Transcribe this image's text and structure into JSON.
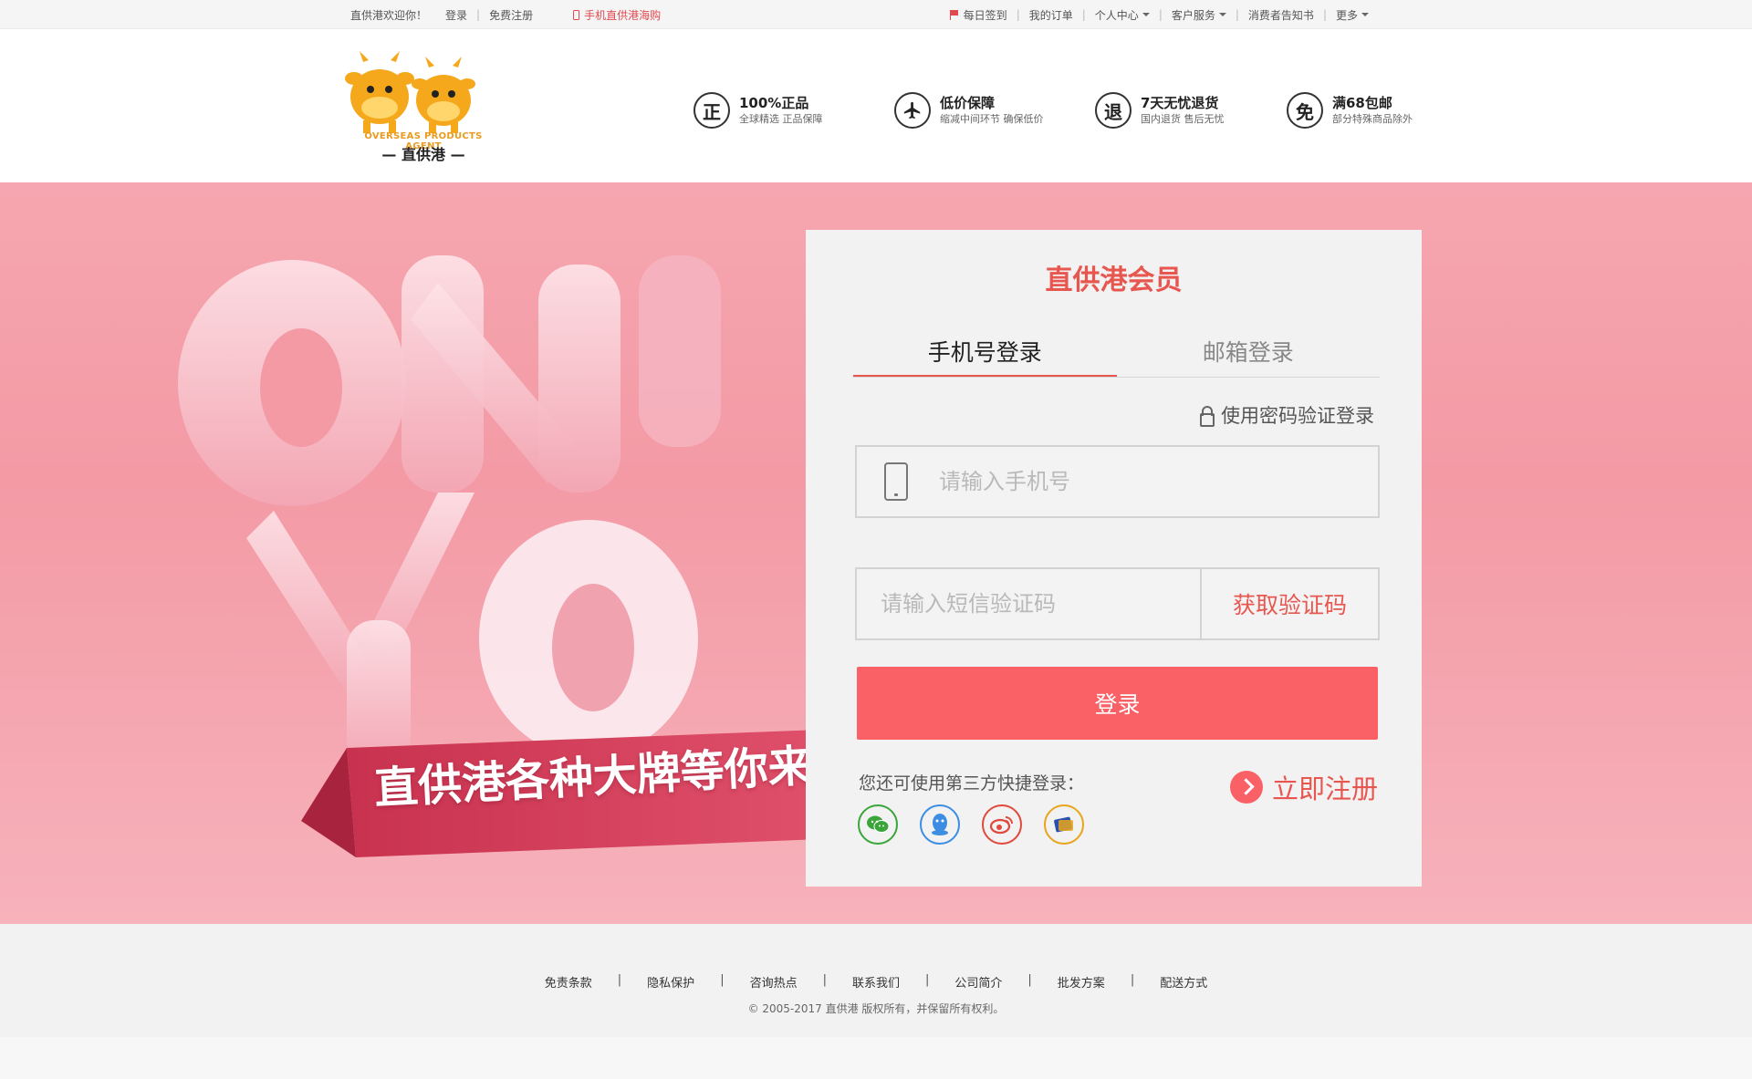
{
  "topbar": {
    "welcome": "直供港欢迎你！",
    "login": "登录",
    "register": "免费注册",
    "mobile": "手机直供港海购",
    "checkin": "每日签到",
    "orders": "我的订单",
    "personal": "个人中心",
    "service": "客户服务",
    "notice": "消费者告知书",
    "more": "更多"
  },
  "logo": {
    "sub": "OVERSEAS PRODUCTS AGENT",
    "name": "— 直供港 —"
  },
  "features": [
    {
      "icon": "正",
      "title": "100%正品",
      "desc": "全球精选 正品保障"
    },
    {
      "icon": "plane",
      "title": "低价保障",
      "desc": "缩减中间环节 确保低价"
    },
    {
      "icon": "退",
      "title": "7天无忧退货",
      "desc": "国内退货 售后无忧"
    },
    {
      "icon": "免",
      "title": "满68包邮",
      "desc": "部分特殊商品除外"
    }
  ],
  "banner": {
    "slogan": "直供港各种大牌等你来"
  },
  "login": {
    "title": "直供港会员",
    "tab_phone": "手机号登录",
    "tab_email": "邮箱登录",
    "pwd_login": "使用密码验证登录",
    "phone_placeholder": "请输入手机号",
    "sms_placeholder": "请输入短信验证码",
    "get_code": "获取验证码",
    "submit": "登录",
    "third_party": "您还可使用第三方快捷登录：",
    "register_now": "立即注册"
  },
  "footer": {
    "links": [
      "免责条款",
      "隐私保护",
      "咨询热点",
      "联系我们",
      "公司简介",
      "批发方案",
      "配送方式"
    ],
    "copyright": "© 2005-2017 直供港 版权所有，并保留所有权利。"
  },
  "colors": {
    "accent": "#e8574f",
    "button": "#fa6166",
    "banner": "#f39aa5"
  }
}
